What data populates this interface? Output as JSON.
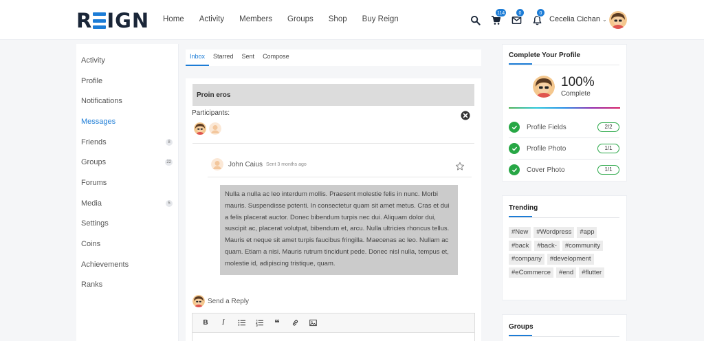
{
  "header": {
    "logo_prefix": "R",
    "logo_suffix": "IGN",
    "nav": [
      "Home",
      "Activity",
      "Members",
      "Groups",
      "Shop",
      "Buy Reign"
    ],
    "badges": {
      "cart": "114",
      "messages": "0",
      "notifications": "0"
    },
    "user_name": "Cecelia Cichan",
    "chevron": "⌄"
  },
  "sidebar": {
    "items": [
      {
        "label": "Activity",
        "count": ""
      },
      {
        "label": "Profile",
        "count": ""
      },
      {
        "label": "Notifications",
        "count": ""
      },
      {
        "label": "Messages",
        "count": ""
      },
      {
        "label": "Friends",
        "count": "8"
      },
      {
        "label": "Groups",
        "count": "22"
      },
      {
        "label": "Forums",
        "count": ""
      },
      {
        "label": "Media",
        "count": "5"
      },
      {
        "label": "Settings",
        "count": ""
      },
      {
        "label": "Coins",
        "count": ""
      },
      {
        "label": "Achievements",
        "count": ""
      },
      {
        "label": "Ranks",
        "count": ""
      }
    ],
    "active_index": 3
  },
  "tabs": [
    "Inbox",
    "Starred",
    "Sent",
    "Compose"
  ],
  "thread": {
    "subject": "Proin eros",
    "participants_label": "Participants:",
    "sender": "John Caius",
    "sent_time": "Sent 3 months ago",
    "body": "Nulla a nulla ac leo interdum mollis. Praesent molestie felis in nunc. Morbi mauris. Suspendisse potenti. In consectetur quam sit amet metus. Cras et dui a felis placerat auctor. Donec bibendum turpis nec dui. Aliquam dolor dui, suscipit ac, placerat volutpat, bibendum et, arcu. Nulla ultricies rhoncus tellus. Mauris et neque sit amet turpis faucibus fringilla. Maecenas ac leo. Nullam ac quam. Etiam a nisi. Mauris rutrum tincidunt pede. Donec nisl nulla, tempus et, molestie id, adipiscing tristique, quam.",
    "reply_label": "Send a Reply",
    "toolbar": {
      "bold": "B",
      "italic": "I",
      "quote": "❝"
    }
  },
  "profile_widget": {
    "title": "Complete Your Profile",
    "percent": "100%",
    "complete_label": "Complete",
    "rows": [
      {
        "label": "Profile Fields",
        "count": "2/2"
      },
      {
        "label": "Profile Photo",
        "count": "1/1"
      },
      {
        "label": "Cover Photo",
        "count": "1/1"
      }
    ]
  },
  "trending": {
    "title": "Trending",
    "tags": [
      "#New",
      "#Wordpress",
      "#app",
      "#back",
      "#back-",
      "#community",
      "#company",
      "#development",
      "#eCommerce",
      "#end",
      "#flutter"
    ]
  },
  "groups_widget": {
    "title": "Groups"
  },
  "colors": {
    "accent": "#1c7cd6",
    "success": "#27a745",
    "brand_dark": "#1a2638"
  },
  "icons": [
    "search-icon",
    "cart-icon",
    "envelope-icon",
    "bell-icon",
    "close-circle-icon",
    "star-outline-icon",
    "check-icon",
    "list-ul-icon",
    "list-ol-icon",
    "link-icon",
    "image-icon"
  ]
}
